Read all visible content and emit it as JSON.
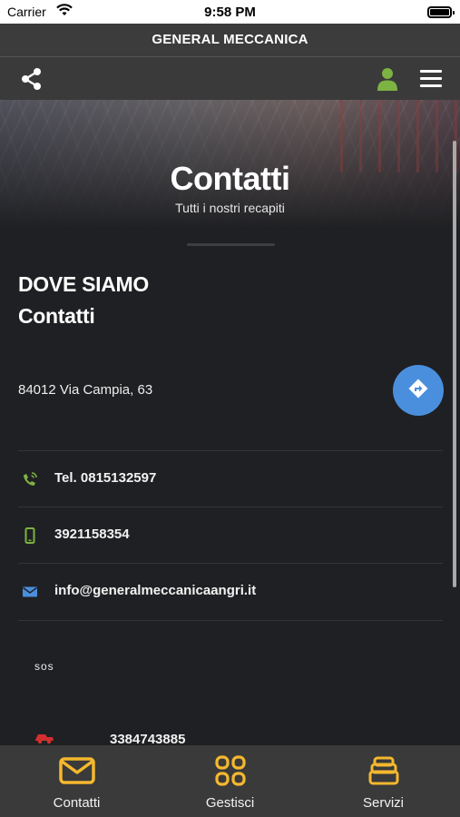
{
  "status_bar": {
    "carrier": "Carrier",
    "time": "9:58 PM"
  },
  "app": {
    "title": "GENERAL MECCANICA"
  },
  "toolbar": {
    "share_icon": "share-icon",
    "user_icon": "user-icon",
    "menu_icon": "hamburger-menu-icon",
    "user_color": "#7cb342"
  },
  "hero": {
    "title": "Contatti",
    "subtitle": "Tutti i nostri recapiti"
  },
  "section": {
    "heading_1": "DOVE SIAMO",
    "heading_2": "Contatti"
  },
  "address": {
    "text": "84012 Via Campia, 63",
    "directions_icon": "directions-icon",
    "button_color": "#4a8fdd"
  },
  "contacts": [
    {
      "icon": "phone-ringing-icon",
      "text": "Tel. 0815132597",
      "color": "#7cb342"
    },
    {
      "icon": "mobile-phone-icon",
      "text": "3921158354",
      "color": "#7cb342"
    },
    {
      "icon": "email-icon",
      "text": "info@generalmeccanicaangri.it",
      "color": "#4a8fdd"
    }
  ],
  "sos": {
    "label": "sos",
    "number": "3384743885",
    "icon": "tow-truck-icon",
    "color": "#d32f2f"
  },
  "tabs": [
    {
      "label": "Contatti",
      "icon": "envelope-icon"
    },
    {
      "label": "Gestisci",
      "icon": "grid-icon"
    },
    {
      "label": "Servizi",
      "icon": "stack-icon"
    }
  ],
  "colors": {
    "accent": "#f5b82e",
    "background": "#1f2023",
    "bar": "#3a3a3a"
  }
}
